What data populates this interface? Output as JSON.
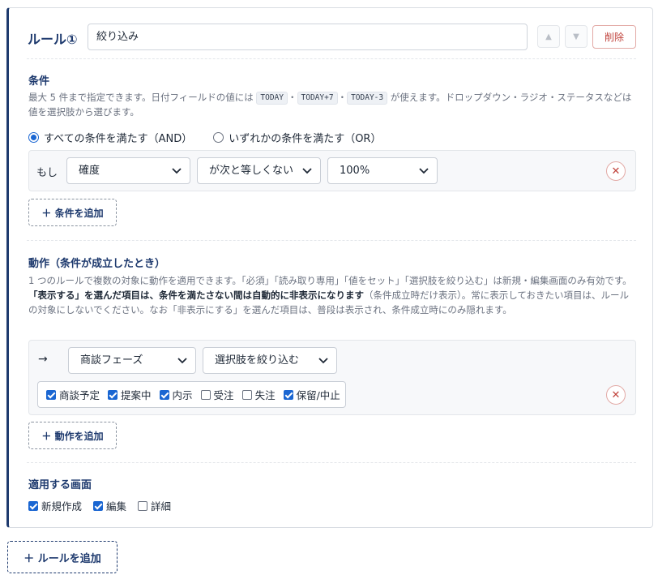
{
  "rule": {
    "title": "ルール①",
    "name_value": "絞り込み",
    "move_up_icon": "triangle-up-icon",
    "move_down_icon": "triangle-down-icon",
    "delete_label": "削除"
  },
  "conditions": {
    "heading": "条件",
    "help_before": "最大 5 件まで指定できます。日付フィールドの値には ",
    "tokens": [
      "TODAY",
      "TODAY+7",
      "TODAY-3"
    ],
    "token_sep": "・",
    "help_after": " が使えます。ドロップダウン・ラジオ・ステータスなどは値を選択肢から選びます。",
    "match_options": [
      {
        "label": "すべての条件を満たす（AND）",
        "selected": true
      },
      {
        "label": "いずれかの条件を満たす（OR）",
        "selected": false
      }
    ],
    "rows": [
      {
        "prefix": "もし",
        "field": "確度",
        "operator": "が次と等しくない",
        "value": "100%"
      }
    ],
    "add_label": "＋ 条件を追加"
  },
  "actions": {
    "heading": "動作（条件が成立したとき）",
    "help_line1": "1 つのルールで複数の対象に動作を適用できます。「必須」「読み取り専用」「値をセット」「選択肢を絞り込む」は新規・編集画面のみ有効です。",
    "help_bold": "「表示する」を選んだ項目は、条件を満たさない間は自動的に非表示になります",
    "help_rest": "（条件成立時だけ表示）。常に表示しておきたい項目は、ルールの対象にしないでください。なお「非表示にする」を選んだ項目は、普段は表示され、条件成立時にのみ隠れます。",
    "rows": [
      {
        "arrow": "→",
        "target": "商談フェーズ",
        "action": "選択肢を絞り込む",
        "choices": [
          {
            "label": "商談予定",
            "checked": true
          },
          {
            "label": "提案中",
            "checked": true
          },
          {
            "label": "内示",
            "checked": true
          },
          {
            "label": "受注",
            "checked": false
          },
          {
            "label": "失注",
            "checked": false
          },
          {
            "label": "保留/中止",
            "checked": true
          }
        ]
      }
    ],
    "add_label": "＋ 動作を追加"
  },
  "screens": {
    "heading": "適用する画面",
    "options": [
      {
        "label": "新規作成",
        "checked": true
      },
      {
        "label": "編集",
        "checked": true
      },
      {
        "label": "詳細",
        "checked": false
      }
    ]
  },
  "add_rule_label": "＋ ルールを追加",
  "colors": {
    "accent": "#1e3a6e",
    "primary": "#1a66d2",
    "danger": "#c0433c"
  }
}
